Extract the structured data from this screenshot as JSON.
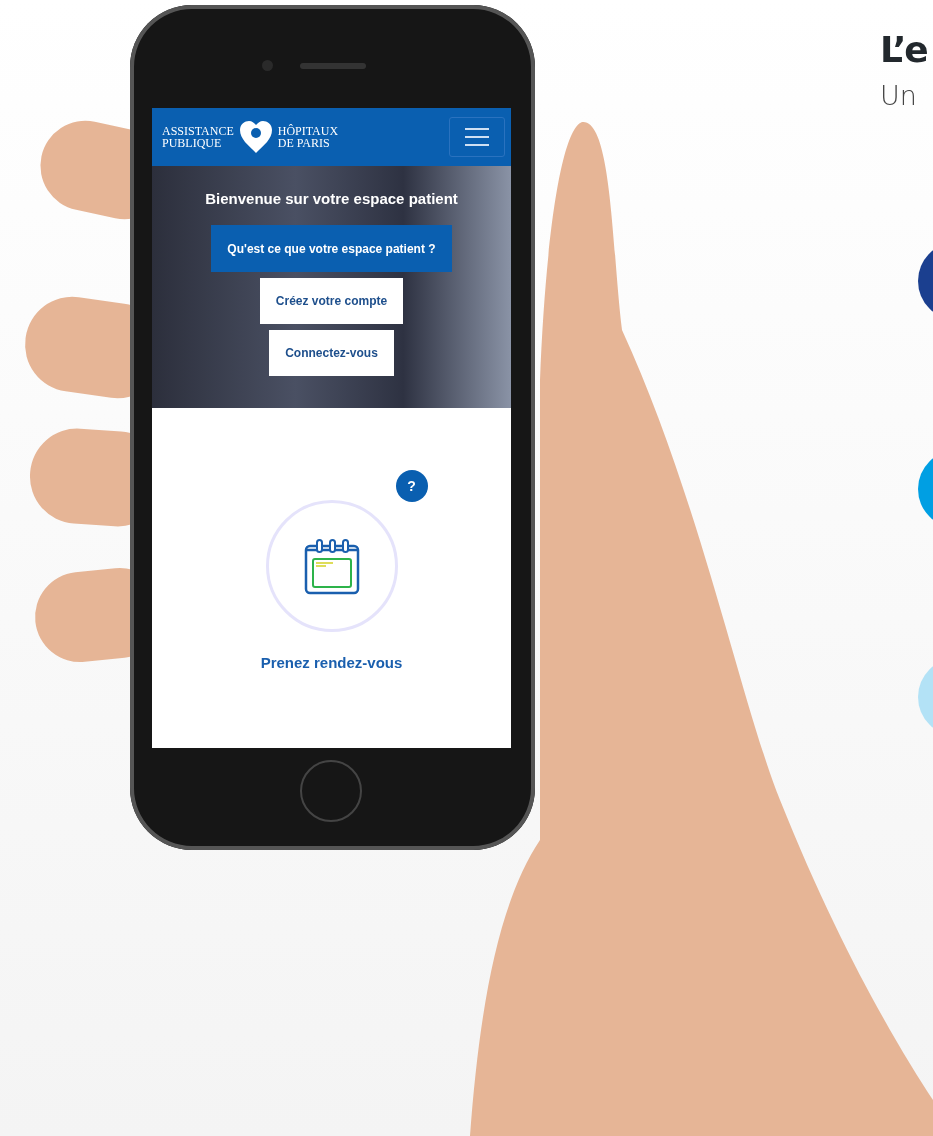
{
  "heading": {
    "title": "L’e",
    "subtitle": "Un"
  },
  "markers": [
    {
      "color": "#1b3f8f"
    },
    {
      "color": "#009fe3"
    },
    {
      "color": "#b3e2f6"
    }
  ],
  "phone": {
    "logo": {
      "left": [
        "ASSISTANCE",
        "PUBLIQUE"
      ],
      "right": [
        "HÔPITAUX",
        "DE PARIS"
      ]
    },
    "hero": {
      "title": "Bienvenue sur votre espace patient",
      "buttons": [
        {
          "label": "Qu'est ce que votre espace patient ?",
          "kind": "primary"
        },
        {
          "label": "Créez votre compte",
          "kind": "secondary"
        },
        {
          "label": "Connectez-vous",
          "kind": "secondary"
        }
      ]
    },
    "service": {
      "label": "Prenez rendez-vous",
      "help": "?"
    }
  }
}
